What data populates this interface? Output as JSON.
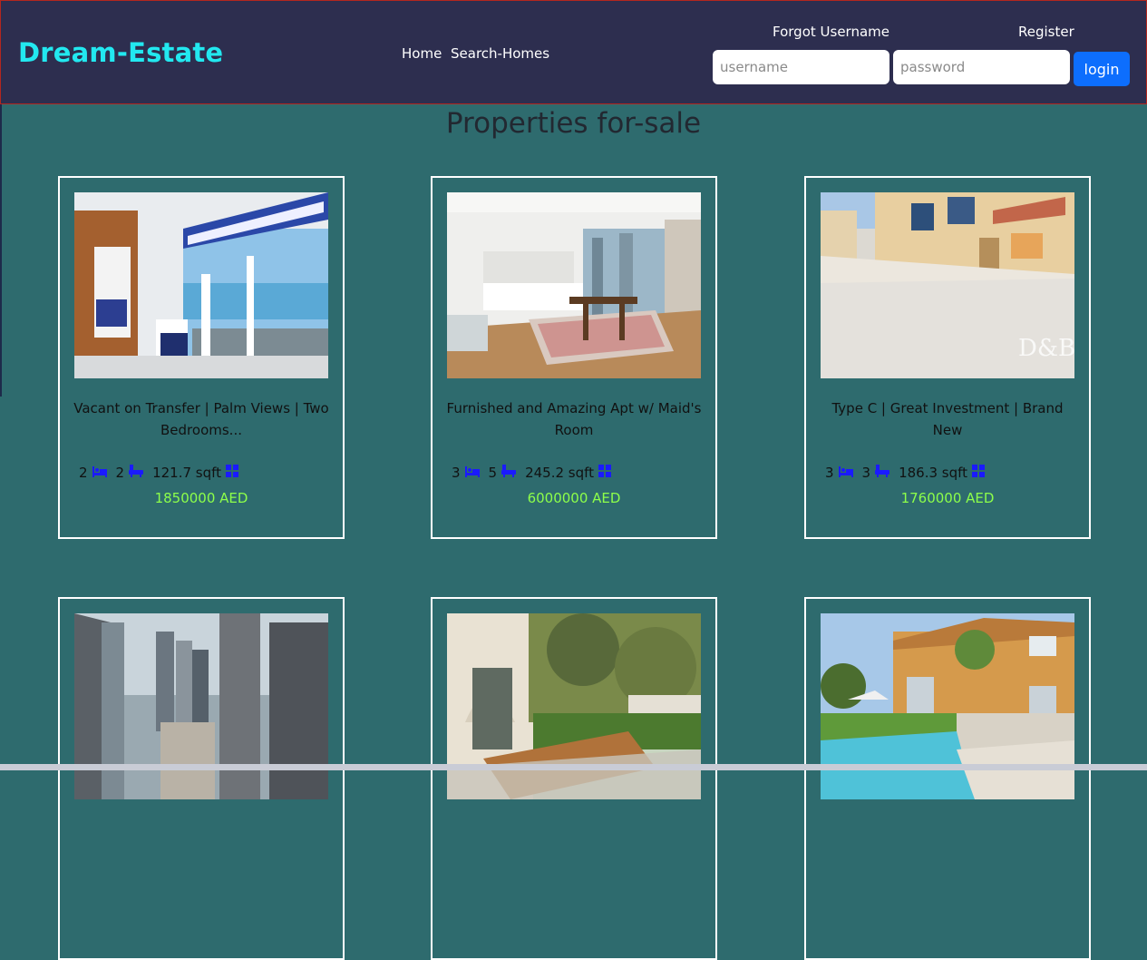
{
  "nav": {
    "brand": "Dream-Estate",
    "links": [
      "Home",
      "Search-Homes"
    ],
    "forgot": "Forgot Username",
    "register": "Register",
    "username_placeholder": "username",
    "password_placeholder": "password",
    "login_label": "login"
  },
  "page_title": "Properties for-sale",
  "listings": [
    {
      "title": "Vacant on Transfer | Palm Views | Two Bedrooms...",
      "beds": "2",
      "baths": "2",
      "area": "121.7 sqft",
      "price": "1850000 AED",
      "photo": "bedroom-sea-view"
    },
    {
      "title": "Furnished and Amazing Apt w/ Maid's Room",
      "beds": "3",
      "baths": "5",
      "area": "245.2 sqft",
      "price": "6000000 AED",
      "photo": "open-plan-living"
    },
    {
      "title": "Type C | Great Investment | Brand New",
      "beds": "3",
      "baths": "3",
      "area": "186.3 sqft",
      "price": "1760000 AED",
      "photo": "townhouse-courtyard"
    },
    {
      "title": "",
      "photo": "skyline-towers"
    },
    {
      "title": "",
      "photo": "villa-garden-table"
    },
    {
      "title": "",
      "photo": "villa-pool"
    }
  ],
  "colors": {
    "navbar": "#2d2e4f",
    "background": "#2e6b6e",
    "brand": "#22e8f0",
    "price": "#8dff4a",
    "icon": "#1a1aff",
    "login": "#0d6efd"
  },
  "icons": [
    "bed-icon",
    "bath-icon",
    "area-grid-icon"
  ]
}
